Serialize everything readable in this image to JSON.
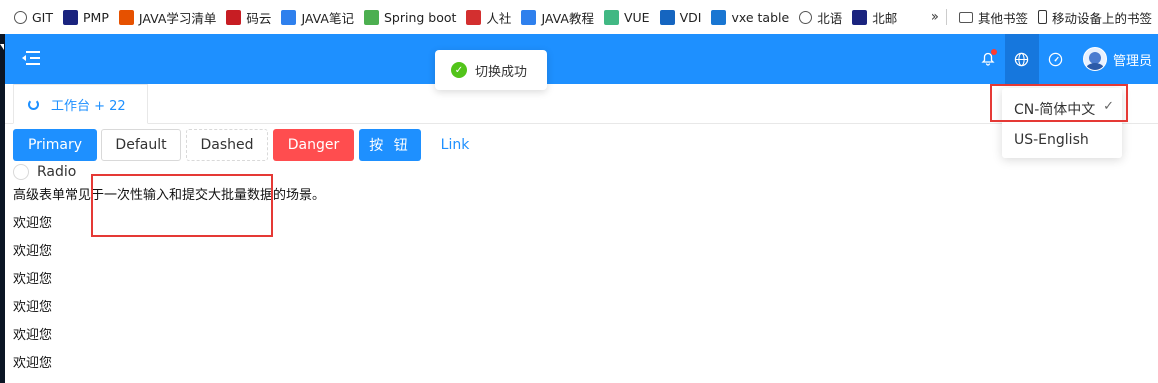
{
  "bookmarks": [
    {
      "label": "GIT",
      "icon": "globe-icon",
      "color": "#555555"
    },
    {
      "label": "PMP",
      "icon": "pm-logo-icon",
      "color": "#1a237e"
    },
    {
      "label": "JAVA学习清单",
      "icon": "csdn-icon",
      "color": "#e65100"
    },
    {
      "label": "码云",
      "icon": "gitee-icon",
      "color": "#c71d23"
    },
    {
      "label": "JAVA笔记",
      "icon": "doc-icon",
      "color": "#2f80ed"
    },
    {
      "label": "Spring boot",
      "icon": "avatar-icon",
      "color": "#4caf50"
    },
    {
      "label": "人社",
      "icon": "party-icon",
      "color": "#d32f2f"
    },
    {
      "label": "JAVA教程",
      "icon": "doc-icon",
      "color": "#2f80ed"
    },
    {
      "label": "VUE",
      "icon": "vue-icon",
      "color": "#41b883"
    },
    {
      "label": "VDI",
      "icon": "vdi-icon",
      "color": "#1565c0"
    },
    {
      "label": "vxe table",
      "icon": "vxe-icon",
      "color": "#1976d2"
    },
    {
      "label": "北语",
      "icon": "globe-icon",
      "color": "#555555"
    },
    {
      "label": "北邮",
      "icon": "bupt-icon",
      "color": "#1a237e"
    }
  ],
  "bookmarks_right": {
    "folder": "其他书签",
    "mobile": "移动设备上的书签"
  },
  "header": {
    "admin": "管理员",
    "accent": "#1e90ff"
  },
  "toast": {
    "message": "切换成功"
  },
  "tab": {
    "label": "工作台 + 22"
  },
  "language_menu": {
    "selected": "CN-简体中文",
    "other": "US-English"
  },
  "buttons": {
    "primary": "Primary",
    "default": "Default",
    "dashed": "Dashed",
    "danger": "Danger",
    "an_niu": "按 钮",
    "link": "Link"
  },
  "radio": {
    "label": "Radio"
  },
  "description": "高级表单常见于一次性输入和提交大批量数据的场景。",
  "welcome_lines": [
    "欢迎您",
    "欢迎您",
    "欢迎您",
    "欢迎您",
    "欢迎您",
    "欢迎您"
  ]
}
